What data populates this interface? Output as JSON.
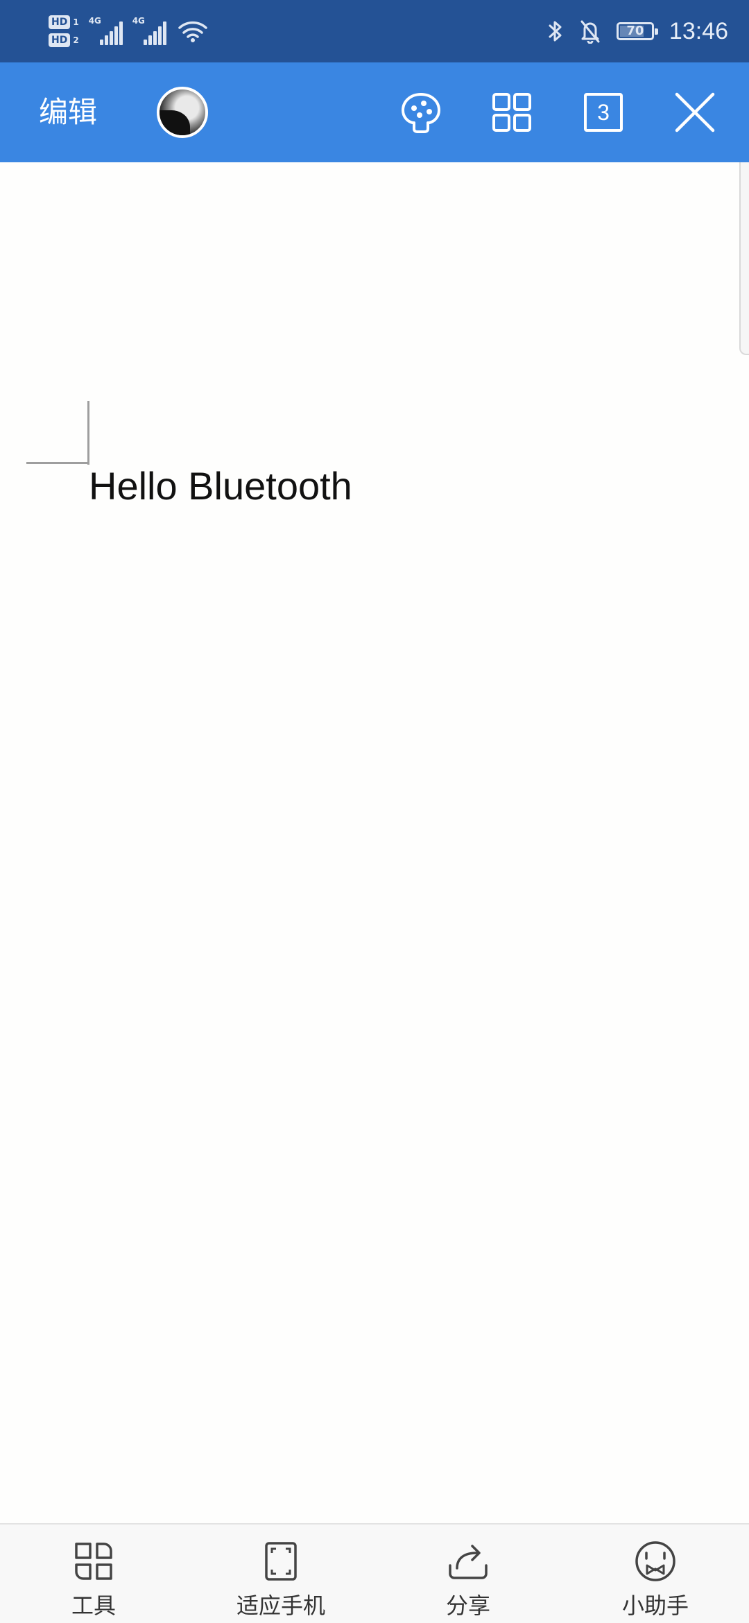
{
  "status_bar": {
    "sim1": "HD",
    "sim1_index": "1",
    "sim2": "HD",
    "sim2_index": "2",
    "network1": "4G",
    "network2": "4G",
    "battery": "70",
    "battery_level_percent": 70,
    "time": "13:46",
    "icons": [
      "bluetooth-icon",
      "notifications-off-icon",
      "battery-icon",
      "wifi-icon"
    ]
  },
  "appbar": {
    "edit_label": "编辑",
    "tab_count": "3",
    "icons": [
      "avatar",
      "palette-icon",
      "grid-icon",
      "tab-count-icon",
      "close-icon"
    ]
  },
  "document": {
    "text": "Hello Bluetooth"
  },
  "bottom_bar": {
    "items": [
      {
        "label": "工具",
        "icon": "tools-grid-icon"
      },
      {
        "label": "适应手机",
        "icon": "fit-screen-icon"
      },
      {
        "label": "分享",
        "icon": "share-icon"
      },
      {
        "label": "小助手",
        "icon": "assistant-face-icon"
      }
    ]
  },
  "colors": {
    "status_bar": "#245295",
    "appbar": "#3a86e2",
    "background": "#fefefd",
    "bottom_bar": "#f8f8f8"
  }
}
